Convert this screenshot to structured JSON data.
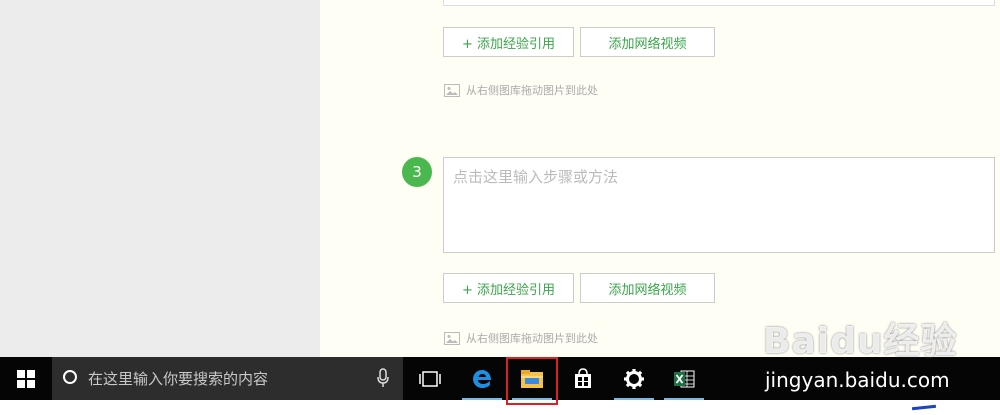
{
  "editor": {
    "add_experience_label": "+ 添加经验引用",
    "add_video_label": "添加网络视频",
    "drag_hint": "从右侧图库拖动图片到此处",
    "step": {
      "number": "3",
      "placeholder": "点击这里输入步骤或方法"
    }
  },
  "taskbar": {
    "search_placeholder": "在这里输入你要搜索的内容",
    "icons": [
      "windows-start-icon",
      "cortana-icon",
      "microphone-icon",
      "task-view-icon",
      "edge-icon",
      "file-explorer-icon",
      "store-icon",
      "settings-icon",
      "excel-icon"
    ],
    "accent": "#76b9ed",
    "highlight_color": "#e02020"
  },
  "watermark": {
    "brand": "Baidu经验",
    "url": "jingyan.baidu.com"
  },
  "colors": {
    "green": "#4bb84f",
    "button_text": "#3aa64a",
    "editor_bg": "#fffef4",
    "left_bg": "#ececec"
  }
}
